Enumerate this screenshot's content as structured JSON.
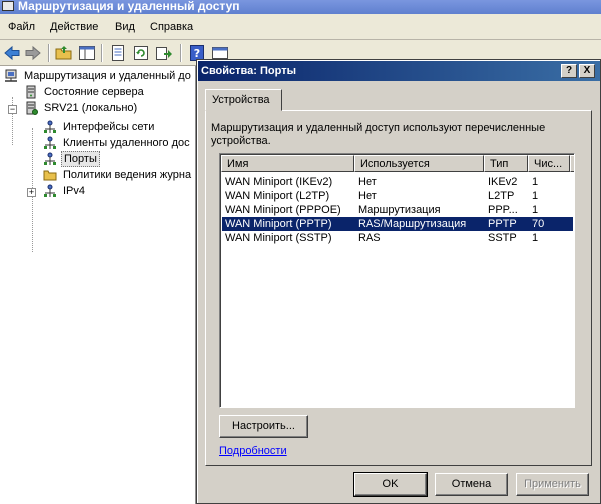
{
  "window": {
    "title": "Маршрутизация и удаленный доступ"
  },
  "menu": [
    "Файл",
    "Действие",
    "Вид",
    "Справка"
  ],
  "toolbar": {
    "icons": [
      "back-icon",
      "forward-icon",
      "up-folder-icon",
      "show-hide-tree-icon",
      "properties-icon",
      "refresh-icon",
      "export-icon",
      "help-icon",
      "console-icon"
    ]
  },
  "tree": {
    "root": "Маршрутизация и удаленный до",
    "server_status": "Состояние сервера",
    "server": "SRV21 (локально)",
    "items": [
      "Интерфейсы сети",
      "Клиенты удаленного дос",
      "Порты",
      "Политики ведения журна",
      "IPv4"
    ]
  },
  "dialog": {
    "title": "Свойства: Порты",
    "help_label": "?",
    "close_label": "X",
    "tab_label": "Устройства",
    "description": "Маршрутизация и удаленный доступ используют перечисленные устройства.",
    "columns": [
      "Имя",
      "Используется",
      "Тип",
      "Чис..."
    ],
    "rows": [
      {
        "name": "WAN Miniport (IKEv2)",
        "used": "Нет",
        "type": "IKEv2",
        "count": "1"
      },
      {
        "name": "WAN Miniport (L2TP)",
        "used": "Нет",
        "type": "L2TP",
        "count": "1"
      },
      {
        "name": "WAN Miniport (PPPOE)",
        "used": "Маршрутизация",
        "type": "PPP...",
        "count": "1"
      },
      {
        "name": "WAN Miniport (PPTP)",
        "used": "RAS/Маршрутизация",
        "type": "PPTP",
        "count": "70"
      },
      {
        "name": "WAN Miniport (SSTP)",
        "used": "RAS",
        "type": "SSTP",
        "count": "1"
      }
    ],
    "configure_label": "Настроить...",
    "details_link": "Подробности",
    "ok_label": "OK",
    "cancel_label": "Отмена",
    "apply_label": "Применить"
  },
  "colors": {
    "selection": "#0a246a",
    "link": "#0000ff",
    "dialog_face": "#d4d0c8"
  }
}
